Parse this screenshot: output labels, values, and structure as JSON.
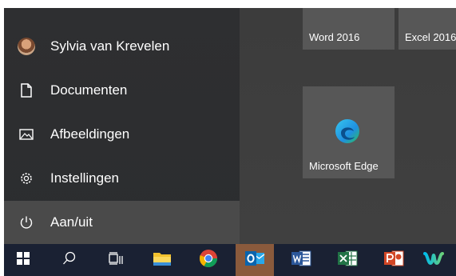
{
  "start_menu": {
    "user": {
      "name": "Sylvia van Krevelen"
    },
    "items": [
      {
        "label": "Documenten",
        "icon": "document-icon"
      },
      {
        "label": "Afbeeldingen",
        "icon": "pictures-icon"
      },
      {
        "label": "Instellingen",
        "icon": "settings-gear-icon"
      },
      {
        "label": "Aan/uit",
        "icon": "power-icon"
      }
    ]
  },
  "tiles": {
    "word": "Word 2016",
    "excel": "Excel 2016",
    "edge": "Microsoft Edge"
  },
  "taskbar": {
    "items": [
      {
        "name": "start-button",
        "icon": "windows-logo-icon"
      },
      {
        "name": "search-button",
        "icon": "search-icon"
      },
      {
        "name": "task-view-button",
        "icon": "task-view-icon"
      },
      {
        "name": "file-explorer-button",
        "icon": "folder-icon"
      },
      {
        "name": "chrome-button",
        "icon": "chrome-icon"
      },
      {
        "name": "outlook-button",
        "icon": "outlook-icon",
        "active": true
      },
      {
        "name": "word-button",
        "icon": "word-icon"
      },
      {
        "name": "excel-button",
        "icon": "excel-icon"
      },
      {
        "name": "powerpoint-button",
        "icon": "powerpoint-icon"
      },
      {
        "name": "webex-button",
        "icon": "webex-icon"
      }
    ]
  },
  "colors": {
    "menu_bg": "#2e2f31",
    "menu_hover": "#4a4a4a",
    "tile_bg": "#575757",
    "taskbar_bg": "#1a2133",
    "taskbar_active": "#8a5a3c"
  }
}
